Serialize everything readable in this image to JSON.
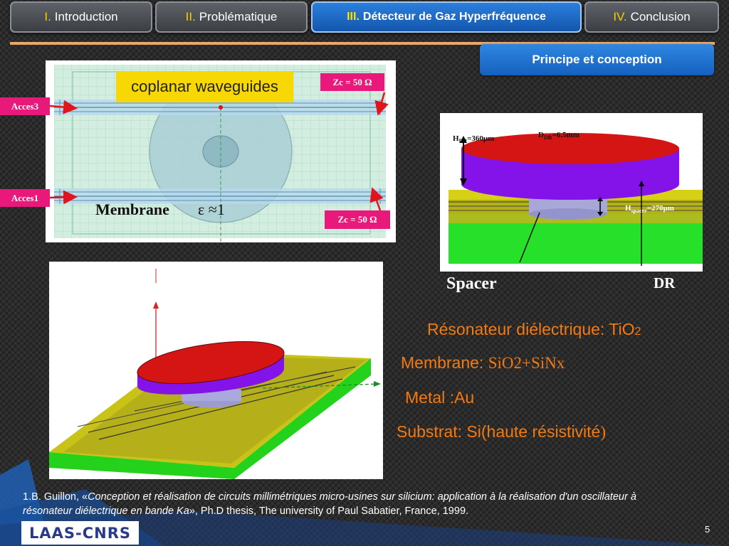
{
  "nav": {
    "tabs": [
      {
        "num": "I.",
        "label": "Introduction"
      },
      {
        "num": "II.",
        "label": "Problématique"
      },
      {
        "num": "III.",
        "label": "Détecteur de Gaz Hyperfréquence"
      },
      {
        "num": "IV.",
        "label": "Conclusion"
      }
    ]
  },
  "section_header": "Principe et conception",
  "fig1": {
    "title": "coplanar waveguides",
    "zc_top": "Zc = 50 Ω",
    "zc_bottom": "Zc = 50 Ω",
    "access3": "Acces3",
    "access1": "Acces1",
    "membrane": "Membrane",
    "epsilon": "ε ≈1"
  },
  "fig2": {
    "h_dr_main": "H",
    "h_dr_sub": "DR",
    "h_dr_val": "=360μm",
    "d_dr_main": "D",
    "d_dr_sub": "DR",
    "d_dr_val": "=6.5mm",
    "h_spacer_main": "H",
    "h_spacer_sub": "spacer",
    "h_spacer_val": "=270μm",
    "spacer_label": "Spacer",
    "dr_label": "DR"
  },
  "bullets": {
    "resonator": "Résonateur diélectrique: TiO",
    "resonator_sub": "2",
    "membrane": "Membrane: ",
    "membrane_mat": "SiO2+SiNx",
    "metal": "Metal :Au",
    "substrate": "Substrat: Si(haute résistivité",
    "substrate_end": ")"
  },
  "reference": {
    "prefix": "1.B. Guillon, «",
    "title": "Conception et réalisation de circuits millimétriques micro-usines sur silicium: application à la réalisation d'un oscillateur à résonateur diélectrique en bande Ka",
    "suffix": "», Ph.D thesis, The university of Paul Sabatier, France, 1999."
  },
  "logo": "LAAS-CNRS",
  "page_number": "5",
  "colors": {
    "accent": "#f37a12",
    "tab_active": "#1c6ccf",
    "tag": "#e8197a"
  }
}
